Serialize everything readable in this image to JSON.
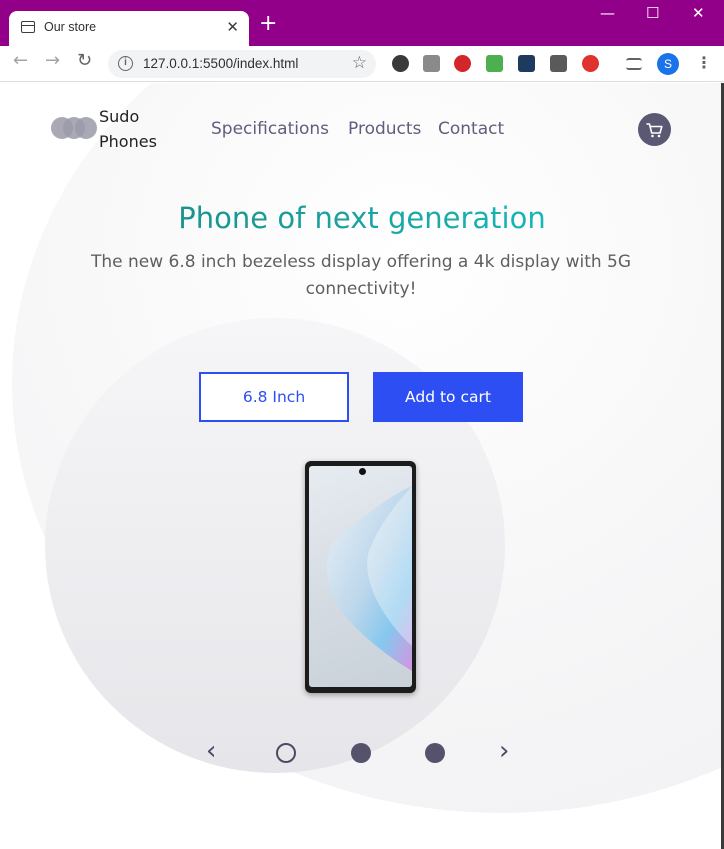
{
  "browser": {
    "tab_title": "Our store",
    "tab_close": "✕",
    "new_tab": "+",
    "url": "127.0.0.1:5500/index.html",
    "profile_initial": "S",
    "window_controls": {
      "minimize": "—",
      "maximize": "☐",
      "close": "✕"
    }
  },
  "site": {
    "brand_line1": "Sudo",
    "brand_line2": "Phones",
    "nav": [
      "Specifications",
      "Products",
      "Contact"
    ]
  },
  "hero": {
    "headline": "Phone of next generation",
    "subtext": "The new 6.8 inch bezeless display offering a 4k display with 5G connectivity!",
    "size_button": "6.8 Inch",
    "cart_button": "Add to cart"
  },
  "slider": {
    "prev": "‹",
    "next": "›",
    "dots": [
      "empty",
      "filled",
      "filled"
    ]
  },
  "colors": {
    "titlebar": "#920089",
    "accent_blue": "#2d4ef2",
    "headline_start": "#16857c",
    "headline_end": "#16c9cf",
    "nav_text": "#5f5f7d"
  },
  "icons": {
    "cart": "shopping-cart-icon",
    "tab_favicon": "store-icon",
    "bookmark": "star-icon"
  }
}
